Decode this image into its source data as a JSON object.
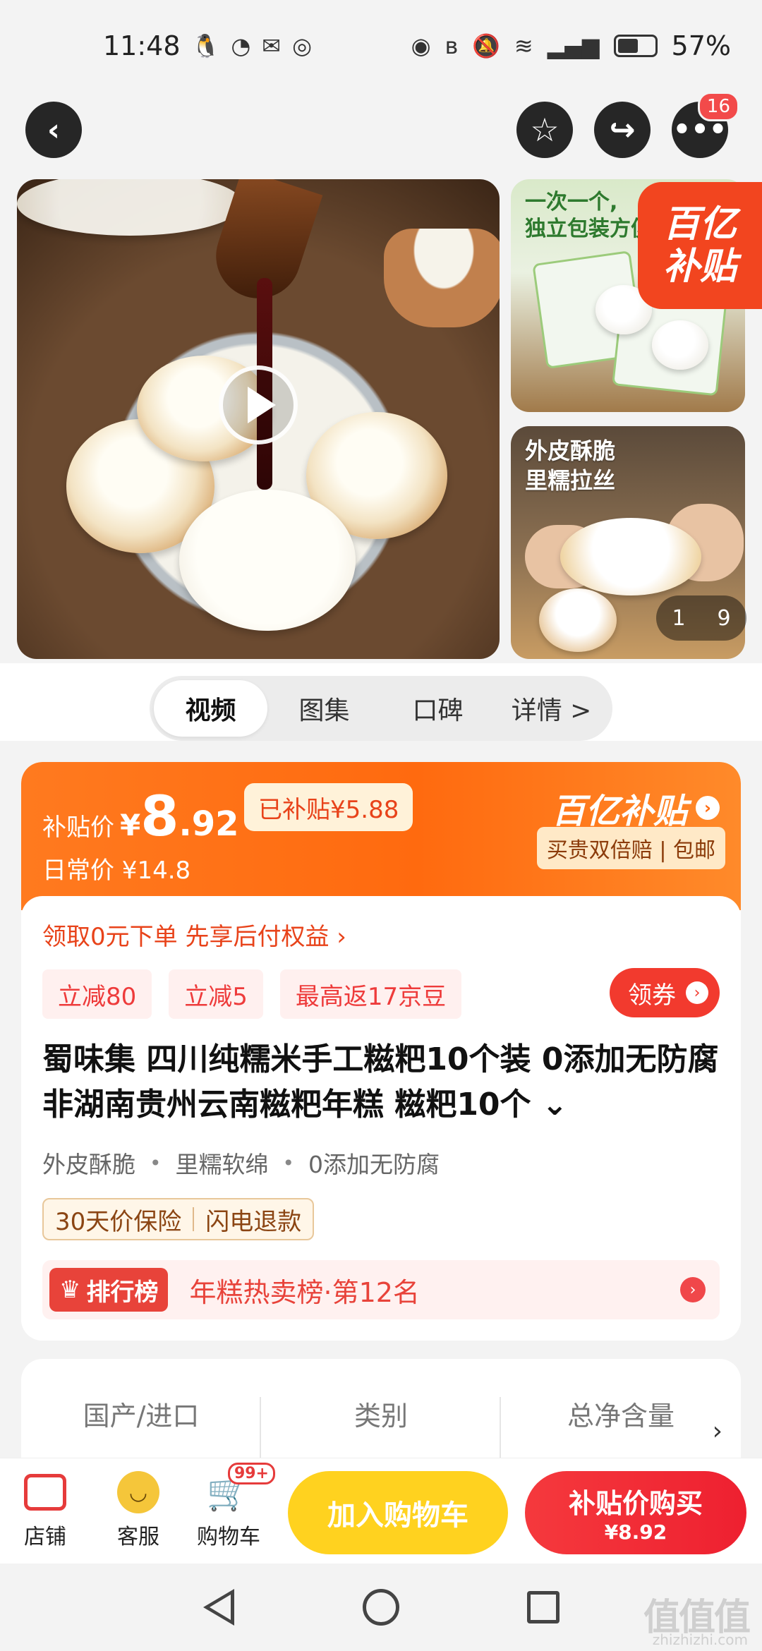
{
  "status_bar": {
    "time": "11:48",
    "battery_percent": "57%",
    "battery_level": 0.57,
    "icons": [
      "qq-icon",
      "wechat-icon",
      "message-icon",
      "location-icon",
      "eye-icon",
      "bluetooth-icon",
      "mute-icon",
      "wifi-icon",
      "signal-icon"
    ]
  },
  "nav": {
    "more_badge": "16"
  },
  "gallery": {
    "thumb1_text": "一次一个,\n独立包装方便",
    "thumb2_text": "外皮酥脆\n里糯拉丝",
    "subsidy_badge_line1": "百亿",
    "subsidy_badge_line2": "补贴",
    "pager_current": "1",
    "pager_total": "9"
  },
  "media_tabs": [
    "视频",
    "图集",
    "口碑",
    "详情 >"
  ],
  "price": {
    "label": "补贴价",
    "yen": "¥",
    "int": "8",
    "dec": ".92",
    "subsidized": "已补贴¥5.88",
    "daily": "日常价 ¥14.8",
    "brand": "百亿补贴",
    "brand_sub": "买贵双倍赔 | 包邮"
  },
  "promo": {
    "link": "领取0元下单 先享后付权益 ›",
    "coupons": [
      "立减80",
      "立减5",
      "最高返17京豆"
    ],
    "get_coupon": "领券"
  },
  "product": {
    "title": "蜀味集 四川纯糯米手工糍粑10个装 0添加无防腐非湖南贵州云南糍粑年糕 糍粑10个 ⌄",
    "features": [
      "外皮酥脆",
      "里糯软绵",
      "0添加无防腐"
    ],
    "guarantees": [
      "30天价保险",
      "闪电退款"
    ],
    "rank_badge": "排行榜",
    "rank_text": "年糕热卖榜·第12名"
  },
  "specs": [
    "国产/进口",
    "类别",
    "总净含量"
  ],
  "action_bar": {
    "store": "店铺",
    "service": "客服",
    "cart": "购物车",
    "cart_badge": "99+",
    "add_to_cart": "加入购物车",
    "buy_line1": "补贴价购买",
    "buy_line2": "¥8.92"
  },
  "watermark": {
    "main": "值值值",
    "sub": "zhizhizhi.com"
  }
}
